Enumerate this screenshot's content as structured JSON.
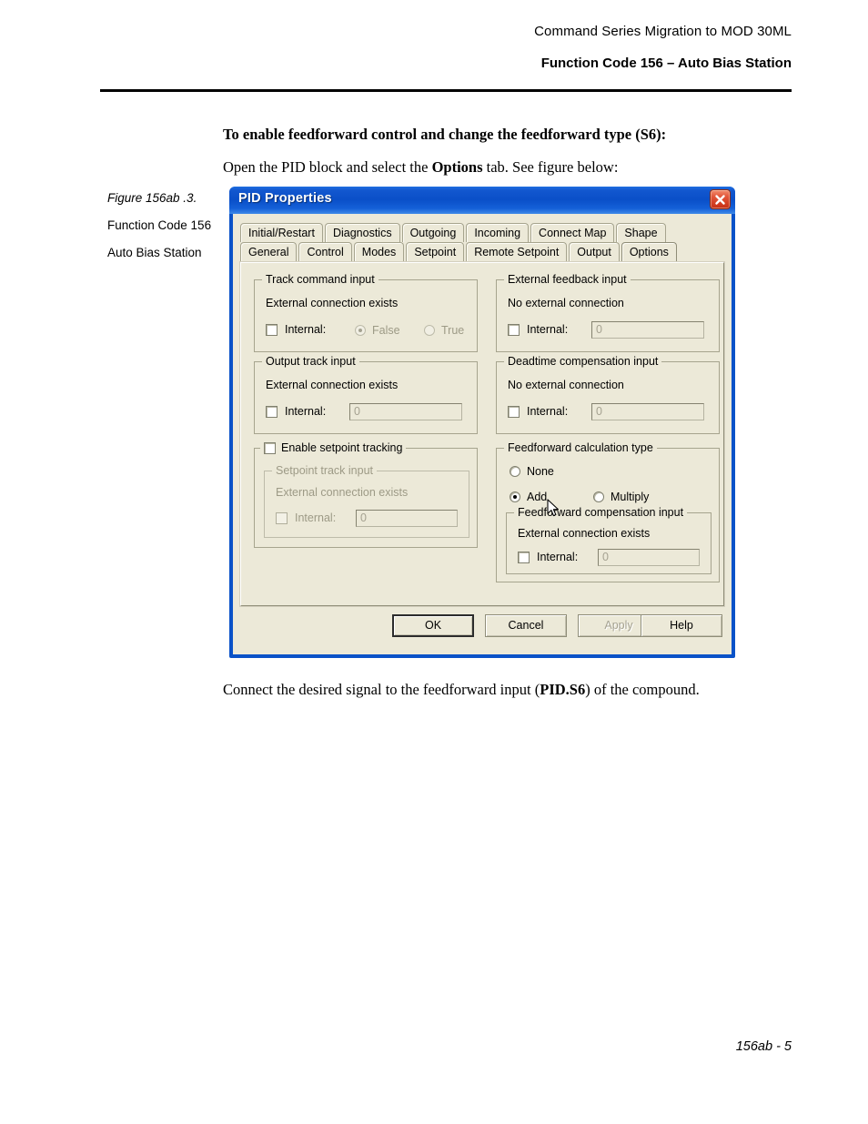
{
  "header": {
    "line1": "Command Series Migration to MOD 30ML",
    "line2": "Function Code 156 – Auto Bias Station"
  },
  "body": {
    "intro_bold": "To enable feedforward control and change the feedforward type (S6):",
    "intro_text_before": "Open the PID block and select the ",
    "intro_text_bold": "Options",
    "intro_text_after": " tab. See figure below:",
    "outro_before": "Connect the desired signal to the feedforward input (",
    "outro_bold": "PID.S6",
    "outro_after": ") of the compound.",
    "page_number": "156ab - 5"
  },
  "caption": {
    "title": "Figure 156ab .3.",
    "line1": "Function Code 156",
    "line2": "Auto Bias Station"
  },
  "dialog": {
    "title": "PID Properties",
    "close_icon": "close-icon",
    "tabs_row1": [
      {
        "label": "Initial/Restart",
        "active": false
      },
      {
        "label": "Diagnostics",
        "active": false
      },
      {
        "label": "Outgoing",
        "active": false
      },
      {
        "label": "Incoming",
        "active": false
      },
      {
        "label": "Connect Map",
        "active": false
      },
      {
        "label": "Shape",
        "active": false
      }
    ],
    "tabs_row2": [
      {
        "label": "General",
        "active": false
      },
      {
        "label": "Control",
        "active": false
      },
      {
        "label": "Modes",
        "active": false
      },
      {
        "label": "Setpoint",
        "active": false
      },
      {
        "label": "Remote Setpoint",
        "active": false
      },
      {
        "label": "Output",
        "active": false
      },
      {
        "label": "Options",
        "active": true
      }
    ],
    "groups": {
      "track_command": {
        "title": "Track command input",
        "note": "External connection exists",
        "internal_label": "Internal:",
        "internal_checked": false,
        "radio_false": "False",
        "radio_true": "True",
        "radio_selected": "False"
      },
      "external_feedback": {
        "title": "External feedback input",
        "note": "No external connection",
        "internal_label": "Internal:",
        "internal_checked": false,
        "value": "0"
      },
      "output_track": {
        "title": "Output track input",
        "note": "External connection exists",
        "internal_label": "Internal:",
        "internal_checked": false,
        "value": "0"
      },
      "deadtime": {
        "title": "Deadtime compensation input",
        "note": "No external connection",
        "internal_label": "Internal:",
        "internal_checked": false,
        "value": "0"
      },
      "setpoint_tracking": {
        "title": "Enable setpoint tracking",
        "checked": false,
        "inner_title": "Setpoint track input",
        "inner_note": "External connection exists",
        "internal_label": "Internal:",
        "internal_checked": false,
        "value": "0"
      },
      "feedforward": {
        "title": "Feedforward calculation type",
        "option_none": "None",
        "option_add": "Add",
        "option_multiply": "Multiply",
        "selected": "Add",
        "inner_title": "Feedforward compensation input",
        "inner_note": "External connection exists",
        "internal_label": "Internal:",
        "internal_checked": false,
        "value": "0"
      }
    },
    "buttons": {
      "ok": "OK",
      "cancel": "Cancel",
      "apply": "Apply",
      "help": "Help",
      "apply_disabled": true
    }
  },
  "colors": {
    "titlebar_blue": "#0a4fc8",
    "dialog_face": "#ece9d8",
    "close_red": "#c62e12",
    "disabled_text": "#9d9a86"
  }
}
